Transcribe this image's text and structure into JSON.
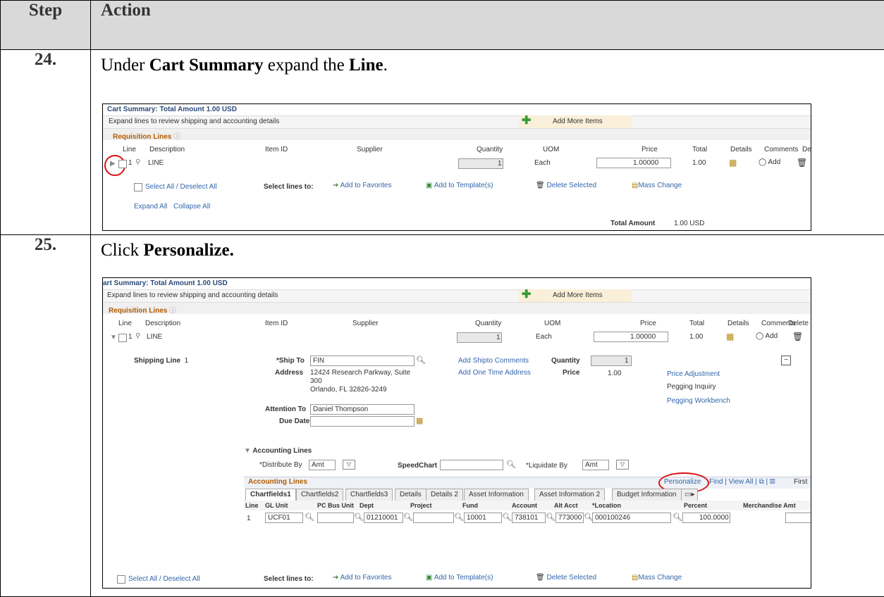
{
  "headers": {
    "step": "Step",
    "action": "Action"
  },
  "step24": {
    "number": "24.",
    "instruction_pre": "Under ",
    "instruction_b1": "Cart Summary",
    "instruction_mid": " expand the ",
    "instruction_b2": "Line",
    "instruction_post": ".",
    "shot": {
      "title": "Cart Summary: Total Amount 1.00 USD",
      "subtitle": "Expand lines to review shipping and accounting details",
      "add_more": "Add More Items",
      "section": "Requisition Lines",
      "cols": [
        "Line",
        "Description",
        "Item ID",
        "Supplier",
        "Quantity",
        "UOM",
        "Price",
        "Total",
        "Details",
        "Comments",
        "De"
      ],
      "line_num": "1",
      "line_desc": "LINE",
      "qty": "1",
      "uom": "Each",
      "price": "1.00000",
      "total": "1.00",
      "comment_add": "Add",
      "select_all": "Select All / Deselect All",
      "select_lines": "Select lines to:",
      "add_fav": "Add to Favorites",
      "add_tmpl": "Add to Template(s)",
      "delete_sel": "Delete Selected",
      "mass_change": "Mass Change",
      "expand_all": "Expand All",
      "collapse_all": "Collapse All",
      "total_amount_label": "Total Amount",
      "total_amount_value": "1.00 USD"
    }
  },
  "step25": {
    "number": "25.",
    "instruction_pre": "Click ",
    "instruction_b1": "Personalize.",
    "shot": {
      "title": "art Summary: Total Amount 1.00 USD",
      "subtitle": "Expand lines to review shipping and accounting details",
      "add_more": "Add More Items",
      "section": "Requisition Lines",
      "cols": [
        "Line",
        "Description",
        "Item ID",
        "Supplier",
        "Quantity",
        "UOM",
        "Price",
        "Total",
        "Details",
        "Comments",
        "Delete"
      ],
      "line_num": "1",
      "line_desc": "LINE",
      "qty": "1",
      "uom": "Each",
      "price": "1.00000",
      "total": "1.00",
      "comment_add": "Add",
      "shipping_line": "Shipping Line",
      "shipping_num": "1",
      "ship_to_label": "*Ship To",
      "ship_to_value": "FIN",
      "address_label": "Address",
      "address_l1": "12424 Research Parkway, Suite",
      "address_l2": "300",
      "address_l3": "Orlando, FL  32826-3249",
      "add_shipto_comments": "Add Shipto Comments",
      "add_one_time": "Add One Time Address",
      "quantity_label": "Quantity",
      "quantity_value": "1",
      "price_label": "Price",
      "price_value": "1.00",
      "price_adjust": "Price Adjustment",
      "pegging_inquiry": "Pegging Inquiry",
      "pegging_workbench": "Pegging Workbench",
      "attention_label": "Attention To",
      "attention_value": "Daniel Thompson",
      "due_date_label": "Due Date",
      "acct_lines_toggle": "Accounting Lines",
      "distribute_label": "*Distribute By",
      "distribute_value": "Amt",
      "speedchart_label": "SpeedChart",
      "liquidate_label": "*Liquidate By",
      "liquidate_value": "Amt",
      "grid_title": "Accounting Lines",
      "personalize": "Personalize",
      "find_view": "Find | View All |",
      "first": "First",
      "tabs": [
        "Chartfields1",
        "Chartfields2",
        "Chartfields3",
        "Details",
        "Details 2",
        "Asset Information",
        "Asset Information 2",
        "Budget Information"
      ],
      "grid_cols": [
        "Line",
        "GL Unit",
        "PC Bus Unit",
        "Dept",
        "Project",
        "Fund",
        "Account",
        "Alt Acct",
        "*Location",
        "Percent",
        "Merchandise Amt"
      ],
      "row": {
        "line": "1",
        "gl_unit": "UCF01",
        "dept": "01210001",
        "fund": "10001",
        "account": "738101",
        "alt_acct": "773000",
        "location": "000100246",
        "percent": "100.0000"
      },
      "select_all": "Select All / Deselect All",
      "select_lines": "Select lines to:",
      "add_fav": "Add to Favorites",
      "add_tmpl": "Add to Template(s)",
      "delete_sel": "Delete Selected",
      "mass_change": "Mass Change"
    }
  }
}
